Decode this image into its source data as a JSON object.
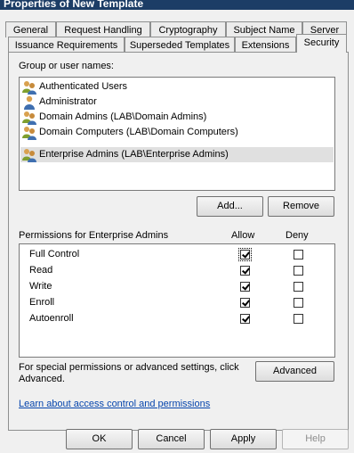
{
  "window": {
    "title": "Properties of New Template"
  },
  "tabs_row1": [
    "General",
    "Request Handling",
    "Cryptography",
    "Subject Name",
    "Server"
  ],
  "tabs_row2": [
    "Issuance Requirements",
    "Superseded Templates",
    "Extensions",
    "Security"
  ],
  "active_tab": "Security",
  "group_section": {
    "label": "Group or user names:",
    "items": [
      {
        "name": "Authenticated Users",
        "icon": "users-group-icon",
        "selected": false
      },
      {
        "name": "Administrator",
        "icon": "user-icon",
        "selected": false
      },
      {
        "name": "Domain Admins (LAB\\Domain Admins)",
        "icon": "users-group-icon",
        "selected": false
      },
      {
        "name": "Domain Computers (LAB\\Domain Computers)",
        "icon": "users-group-icon",
        "selected": false
      },
      {
        "name": "Enterprise Admins (LAB\\Enterprise Admins)",
        "icon": "users-group-icon",
        "selected": true
      }
    ],
    "add_button": "Add...",
    "remove_button": "Remove"
  },
  "permissions": {
    "header": "Permissions for Enterprise Admins",
    "allow_header": "Allow",
    "deny_header": "Deny",
    "rows": [
      {
        "name": "Full Control",
        "allow": true,
        "deny": false
      },
      {
        "name": "Read",
        "allow": true,
        "deny": false
      },
      {
        "name": "Write",
        "allow": true,
        "deny": false
      },
      {
        "name": "Enroll",
        "allow": true,
        "deny": false
      },
      {
        "name": "Autoenroll",
        "allow": true,
        "deny": false
      }
    ]
  },
  "advanced": {
    "text_line1": "For special permissions or advanced settings, click",
    "text_line2": "Advanced.",
    "button": "Advanced"
  },
  "help_link": "Learn about access control and permissions",
  "footer": {
    "ok": "OK",
    "cancel": "Cancel",
    "apply": "Apply",
    "help": "Help"
  },
  "colors": {
    "titlebar": "#1c3d66",
    "dialog_bg": "#f0f0f0",
    "link": "#0645ad",
    "selection": "#e0e0e0"
  }
}
